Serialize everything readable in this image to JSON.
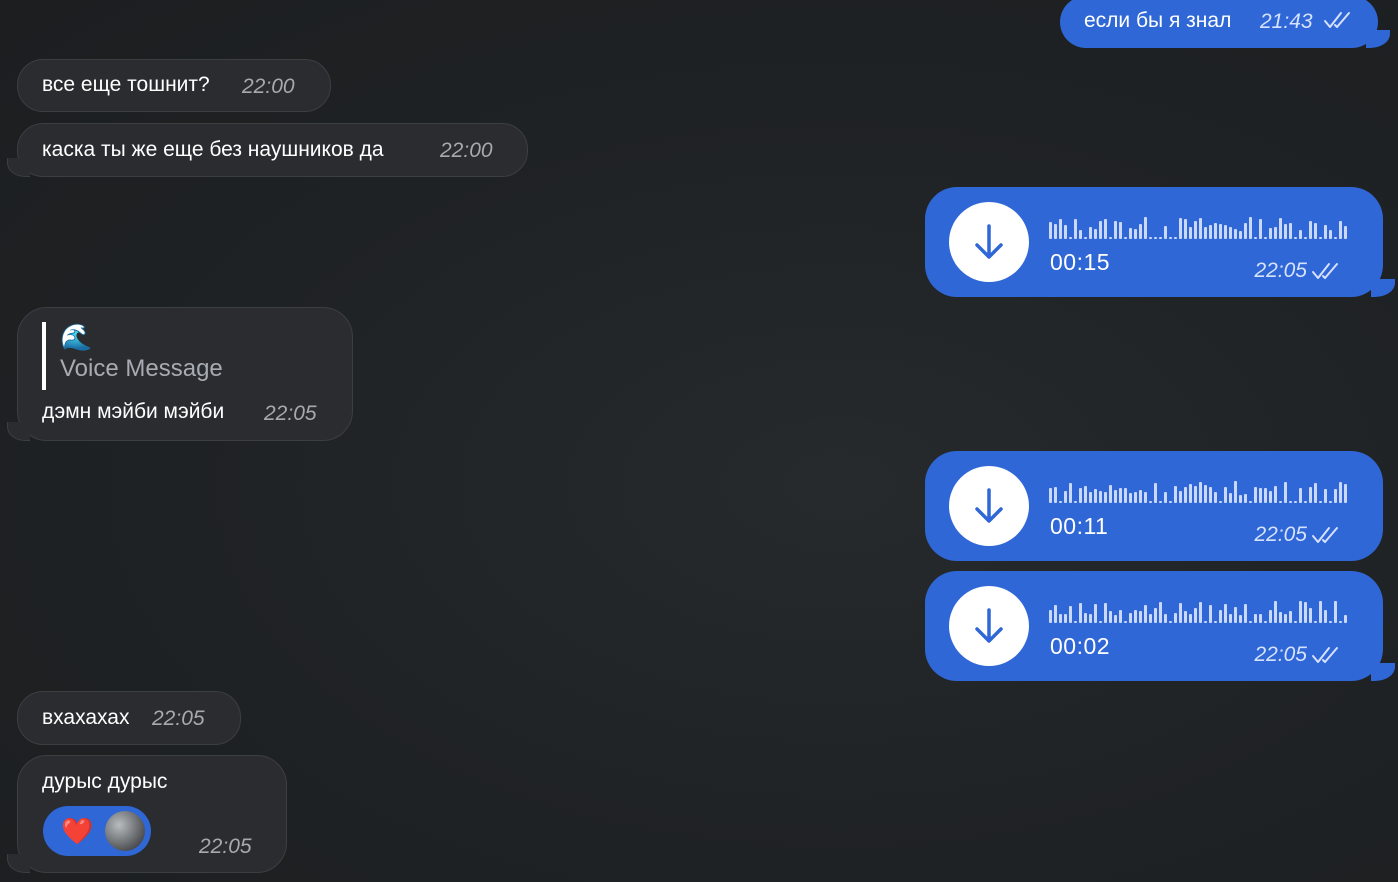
{
  "messages": {
    "m1": {
      "text": "если бы я знал",
      "time": "21:43",
      "status": "read"
    },
    "m2": {
      "text": "все еще тошнит?",
      "time": "22:00"
    },
    "m3": {
      "text": "каска ты же еще без наушников да",
      "time": "22:00"
    },
    "m4": {
      "type": "voice",
      "duration": "00:15",
      "time": "22:05",
      "status": "read"
    },
    "m5": {
      "quote_emoji": "🌊",
      "quote_text": "Voice Message",
      "text": "дэмн мэйби мэйби",
      "time": "22:05"
    },
    "m6": {
      "type": "voice",
      "duration": "00:11",
      "time": "22:05",
      "status": "read"
    },
    "m7": {
      "type": "voice",
      "duration": "00:02",
      "time": "22:05",
      "status": "read"
    },
    "m8": {
      "text": "вхахахах",
      "time": "22:05"
    },
    "m9": {
      "text": "дурыс дурыс",
      "time": "22:05",
      "reaction": {
        "emoji": "❤️",
        "icon": "reactor-avatar"
      }
    }
  },
  "colors": {
    "background": "#1e2022",
    "incoming_bubble": "#2a2c2f",
    "outgoing_bubble": "#2f67d6",
    "accent": "#2f67d6"
  },
  "icons": {
    "download": "arrow-down-icon",
    "read_status": "double-check-icon"
  }
}
